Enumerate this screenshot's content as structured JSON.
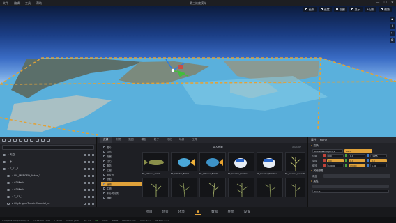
{
  "window": {
    "title": "第三维度模拟",
    "menu": [
      "文件",
      "编辑",
      "工具",
      "帮助"
    ],
    "controls": [
      "—",
      "☐",
      "✕"
    ]
  },
  "viewport": {
    "toolbar": [
      "画质",
      "速度",
      "视图",
      "显示",
      "+日照",
      "视角"
    ],
    "side_buttons": [
      "⌖",
      "+",
      "↔",
      "⊕"
    ]
  },
  "hierarchy": {
    "rows": [
      {
        "label": "天空",
        "indent": 0,
        "expand": "▾"
      },
      {
        "label": "水",
        "indent": 0,
        "expand": "▸"
      },
      {
        "label": "T_01_1",
        "indent": 0,
        "expand": "▾"
      },
      {
        "label": "SM_MERGED_Actor_1",
        "indent": 1,
        "expand": "▸"
      },
      {
        "label": "ADMesh",
        "indent": 1,
        "expand": "▸"
      },
      {
        "label": "ADMesh",
        "indent": 1,
        "expand": "▸"
      },
      {
        "label": "T_01_1",
        "indent": 1,
        "expand": "▸"
      },
      {
        "label": "CityEngineTerrainMaterial_m",
        "indent": 1,
        "expand": "▸"
      },
      {
        "label": "Plane",
        "indent": 2,
        "expand": "",
        "selected": true
      }
    ]
  },
  "assets": {
    "tabs": [
      "资源",
      "材质",
      "贴图",
      "模型",
      "粒子",
      "灯光",
      "场景",
      "工具"
    ],
    "active_tab": 0,
    "categories": [
      "图片",
      "动态",
      "电器",
      "动力",
      "服务",
      "工程",
      "图片色",
      "模型",
      "植物",
      "生物",
      "未分类分类",
      "植被"
    ],
    "active_category": 8,
    "header_title": "导入资源",
    "count": "357/357",
    "items": [
      {
        "label": "FS_UWater_FishSl",
        "thumb": "fish-dark"
      },
      {
        "label": "FS_UWater_FishSl",
        "thumb": "fish-blue"
      },
      {
        "label": "FS_UWater_FishSl",
        "thumb": "fish-blue"
      },
      {
        "label": "FS_Uwater_FishPlar",
        "thumb": "fish-white"
      },
      {
        "label": "FS_Uwater_FishPlar",
        "thumb": "fish-white"
      },
      {
        "label": "FS_Uwater_GrassP",
        "thumb": "plant"
      },
      {
        "label": "",
        "thumb": "plant"
      },
      {
        "label": "",
        "thumb": "plant"
      },
      {
        "label": "",
        "thumb": "plant"
      },
      {
        "label": "",
        "thumb": "plant"
      },
      {
        "label": "",
        "thumb": "plant"
      },
      {
        "label": "",
        "thumb": "plant"
      }
    ]
  },
  "properties": {
    "header_label": "属性",
    "object_name": "Plane",
    "section_transform": "变换",
    "mesh_id": "SceneMeshObject_1",
    "rows": [
      {
        "name": "位置",
        "x": "0.0",
        "y": "0.0",
        "z": "-1455"
      },
      {
        "name": "旋转",
        "x": "0.0",
        "y": "0.0",
        "z": "0.0"
      },
      {
        "name": "缩放",
        "x": "13000",
        "y": "13000",
        "z": "1.00"
      }
    ],
    "section_extra": "其他数据",
    "extra_label": "覆盖",
    "section_more": "属性",
    "bottom_field": "Preset"
  },
  "bottomnav": {
    "items": [
      "项目",
      "场景",
      "环境",
      "",
      "数据",
      "界面",
      "设置"
    ],
    "active": 3
  },
  "status": {
    "items": [
      "X:0:0/PPN:2000/0/0/08/2.ll",
      "E:0.12.003 | 0.05",
      "FPS: 61",
      "Fr:0.02 | 0.50",
      "Sh: 3.5",
      "OK",
      "Plane",
      "Scene",
      "Renderer: OK",
      "Time: 4.4:4",
      "Version: 4.1.4"
    ]
  },
  "colors": {
    "accent": "#e0a23a",
    "panel": "#222328",
    "ocean": "#5ab0dc"
  }
}
